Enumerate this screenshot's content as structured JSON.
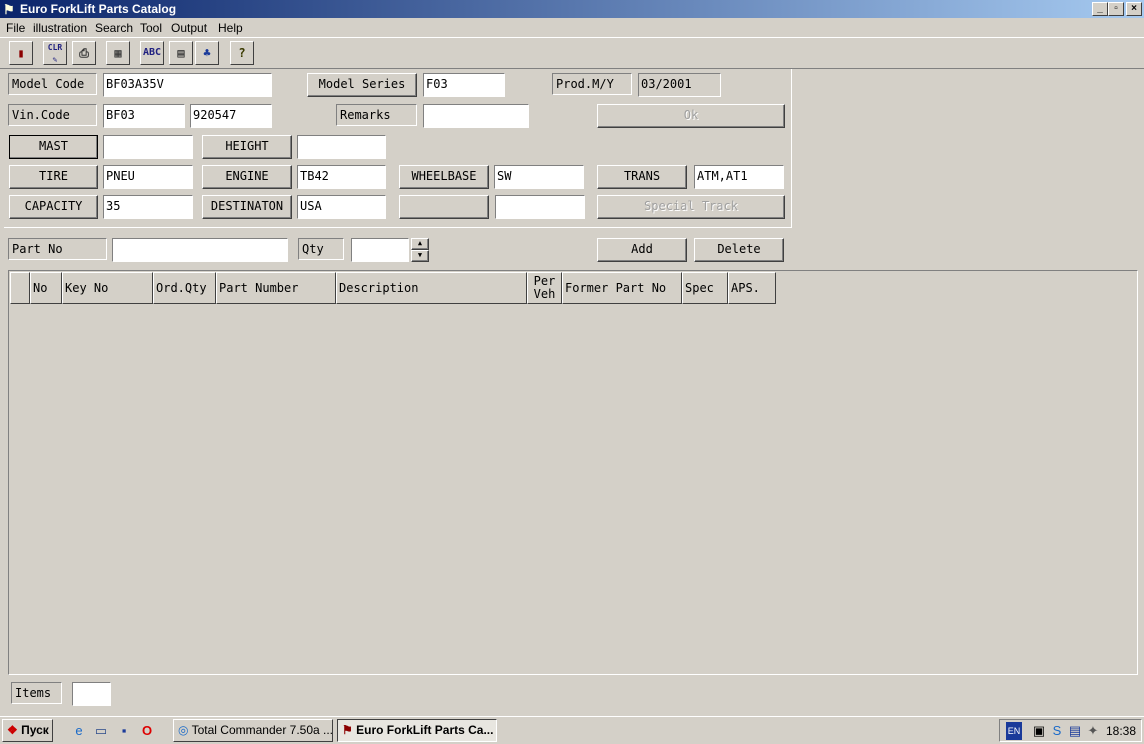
{
  "window": {
    "title": "Euro ForkLift Parts Catalog",
    "controls": {
      "minimize": "_",
      "restore": "▫",
      "close": "×"
    }
  },
  "menu": [
    "File",
    "illustration",
    "Search",
    "Tool",
    "Output",
    "Help"
  ],
  "toolbar": {
    "icons": [
      "exit-door-icon",
      "clear-icon",
      "print-icon",
      "calculator-icon",
      "spell-abc-icon",
      "book-icon",
      "tree-icon",
      "help-icon"
    ],
    "clr_label": "CLR",
    "abc_label": "ABC"
  },
  "form": {
    "model_code_label": "Model Code",
    "model_code_value": "BF03A35V",
    "model_series_label": "Model Series",
    "model_series_value": "F03",
    "prod_label": "Prod.M/Y",
    "prod_value": "03/2001",
    "vin_label": "Vin.Code",
    "vin_value1": "BF03",
    "vin_value2": "920547",
    "remarks_label": "Remarks",
    "remarks_value": "",
    "ok_label": "Ok",
    "mast_label": "MAST",
    "mast_value": "",
    "height_label": "HEIGHT",
    "height_value": "",
    "tire_label": "TIRE",
    "tire_value": "PNEU",
    "engine_label": "ENGINE",
    "engine_value": "TB42",
    "wheelbase_label": "WHEELBASE",
    "wheelbase_value": "SW",
    "trans_label": "TRANS",
    "trans_value": "ATM,AT1",
    "capacity_label": "CAPACITY",
    "capacity_value": "35",
    "destination_label": "DESTINATON",
    "destination_value": "USA",
    "blank_label": "",
    "blank_value": "",
    "special_track_label": "Special Track"
  },
  "entry": {
    "part_no_label": "Part No",
    "part_no_value": "",
    "qty_label": "Qty",
    "qty_value": "",
    "add_label": "Add",
    "delete_label": "Delete"
  },
  "grid": {
    "columns": [
      "",
      "No",
      "Key No",
      "Ord.Qty",
      "Part Number",
      "Description",
      "Per\nVeh",
      "Former Part No",
      "Spec",
      "APS."
    ],
    "rows": []
  },
  "footer": {
    "items_label": "Items",
    "items_value": ""
  },
  "taskbar": {
    "start_label": "Пуск",
    "tasks": [
      "Total Commander 7.50a ...",
      "Euro ForkLift Parts Ca..."
    ],
    "lang": "EN",
    "clock": "18:38"
  }
}
